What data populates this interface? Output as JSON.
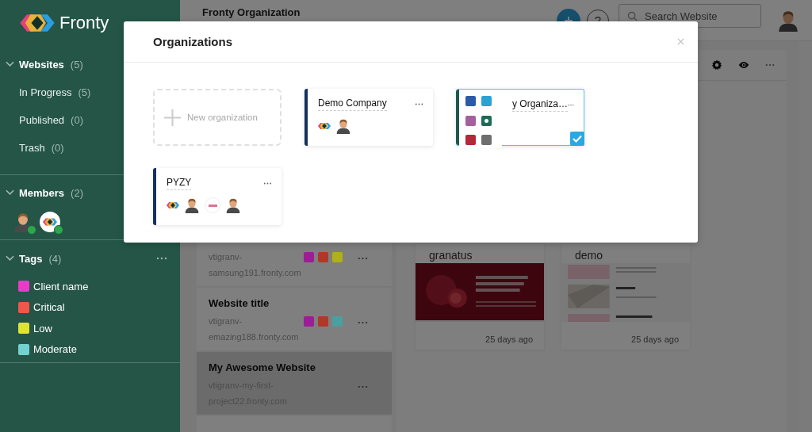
{
  "sidebar": {
    "brand": "Fronty",
    "websites": {
      "title": "Websites",
      "count": "(5)",
      "expanded": true,
      "items": [
        {
          "label": "In Progress",
          "count": "(5)"
        },
        {
          "label": "Published",
          "count": "(0)"
        },
        {
          "label": "Trash",
          "count": "(0)"
        }
      ]
    },
    "members": {
      "title": "Members",
      "count": "(2)",
      "expanded": true,
      "avatars": [
        {
          "kind": "person",
          "online": true
        },
        {
          "kind": "logo",
          "online": true
        }
      ]
    },
    "tags": {
      "title": "Tags",
      "count": "(4)",
      "expanded": true,
      "items": [
        {
          "label": "Client name",
          "color": "#e83cc6"
        },
        {
          "label": "Critical",
          "color": "#f0564a"
        },
        {
          "label": "Low",
          "color": "#e2e232"
        },
        {
          "label": "Moderate",
          "color": "#72d2d0"
        }
      ]
    }
  },
  "header": {
    "title": "Fronty Organization",
    "help": "?",
    "search": {
      "placeholder": "Search Website"
    }
  },
  "websites": [
    {
      "url": "vtigranv-samsung191.fronty.com",
      "tags": [
        {
          "color": "#9c1e96"
        },
        {
          "color": "#b03828"
        },
        {
          "color": "#b0b018"
        }
      ],
      "selected": false
    },
    {
      "title": "Website title",
      "url": "vtigranv-emazing188.fronty.com",
      "tags": [
        {
          "color": "#9c1e96"
        },
        {
          "color": "#b03828"
        },
        {
          "color": "#4aa0a0"
        }
      ],
      "selected": false
    },
    {
      "title": "My Awesome Website",
      "url": "vtigranv-my-first-project22.fronty.com",
      "selected": true
    },
    {
      "selected": false
    }
  ],
  "site_cards": [
    {
      "title": "granatus",
      "updated": "25 days ago"
    },
    {
      "title": "demo",
      "updated": "25 days ago"
    }
  ],
  "modal": {
    "title": "Organizations",
    "new_label": "New organization",
    "organizations": [
      {
        "name": "Demo Company",
        "color": "#14305f",
        "selected": false,
        "members": [
          {
            "kind": "logo"
          },
          {
            "kind": "person"
          }
        ]
      },
      {
        "name": "y Organiza…",
        "color": "#1d5a4b",
        "selected": true,
        "color_picker": [
          {
            "color": "#2b5ba8",
            "selected": false
          },
          {
            "color": "#2aa3d4",
            "selected": false
          },
          {
            "color": "#a2619c",
            "selected": false
          },
          {
            "color": "#1d6b56",
            "selected": true
          },
          {
            "color": "#b3283a",
            "selected": false
          },
          {
            "color": "#6e6e6e",
            "selected": false
          }
        ]
      },
      {
        "name": "PYZY",
        "color": "#14305f",
        "selected": false,
        "members": [
          {
            "kind": "logo"
          },
          {
            "kind": "person"
          },
          {
            "kind": "badge"
          },
          {
            "kind": "person"
          }
        ]
      }
    ]
  }
}
